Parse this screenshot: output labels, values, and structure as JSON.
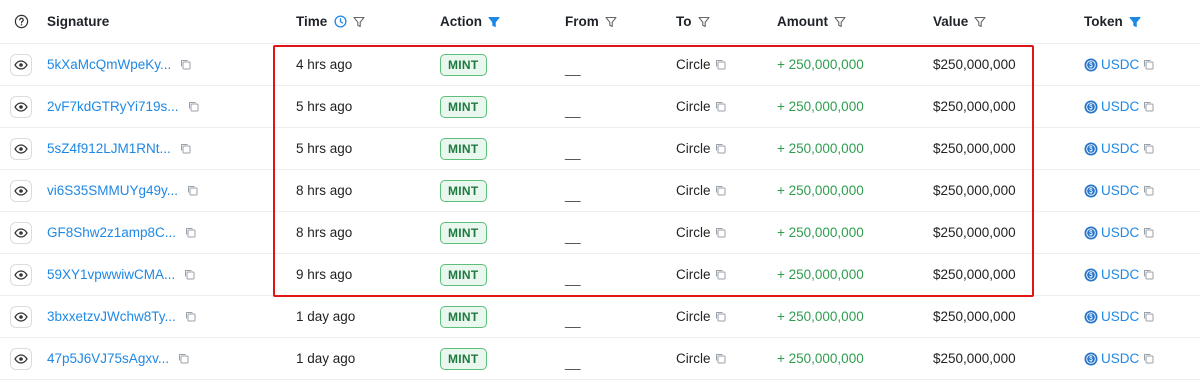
{
  "header": {
    "help_icon": "help-circle-icon",
    "signature": "Signature",
    "time": "Time",
    "action": "Action",
    "from": "From",
    "to": "To",
    "amount": "Amount",
    "value": "Value",
    "token": "Token"
  },
  "colors": {
    "link": "#1e88e5",
    "amount_positive": "#2e9e4f",
    "badge_border": "#5cbf7a",
    "badge_bg": "#e9f7ee",
    "highlight": "#e01515",
    "active_filter": "#1e88e5"
  },
  "active_filters": [
    "Action",
    "Token"
  ],
  "rows": [
    {
      "signature": "5kXaMcQmWpeKy...",
      "time": "4 hrs ago",
      "action": "MINT",
      "from": "__",
      "to": "Circle",
      "amount": "+ 250,000,000",
      "value": "$250,000,000",
      "token": "USDC"
    },
    {
      "signature": "2vF7kdGTRyYi719s...",
      "time": "5 hrs ago",
      "action": "MINT",
      "from": "__",
      "to": "Circle",
      "amount": "+ 250,000,000",
      "value": "$250,000,000",
      "token": "USDC"
    },
    {
      "signature": "5sZ4f912LJM1RNt...",
      "time": "5 hrs ago",
      "action": "MINT",
      "from": "__",
      "to": "Circle",
      "amount": "+ 250,000,000",
      "value": "$250,000,000",
      "token": "USDC"
    },
    {
      "signature": "vi6S35SMMUYg49y...",
      "time": "8 hrs ago",
      "action": "MINT",
      "from": "__",
      "to": "Circle",
      "amount": "+ 250,000,000",
      "value": "$250,000,000",
      "token": "USDC"
    },
    {
      "signature": "GF8Shw2z1amp8C...",
      "time": "8 hrs ago",
      "action": "MINT",
      "from": "__",
      "to": "Circle",
      "amount": "+ 250,000,000",
      "value": "$250,000,000",
      "token": "USDC"
    },
    {
      "signature": "59XY1vpwwiwCMA...",
      "time": "9 hrs ago",
      "action": "MINT",
      "from": "__",
      "to": "Circle",
      "amount": "+ 250,000,000",
      "value": "$250,000,000",
      "token": "USDC"
    },
    {
      "signature": "3bxxetzvJWchw8Ty...",
      "time": "1 day ago",
      "action": "MINT",
      "from": "__",
      "to": "Circle",
      "amount": "+ 250,000,000",
      "value": "$250,000,000",
      "token": "USDC"
    },
    {
      "signature": "47p5J6VJ75sAgxv...",
      "time": "1 day ago",
      "action": "MINT",
      "from": "__",
      "to": "Circle",
      "amount": "+ 250,000,000",
      "value": "$250,000,000",
      "token": "USDC"
    }
  ],
  "highlighted_rows": [
    1,
    2,
    3,
    4,
    5,
    6
  ]
}
